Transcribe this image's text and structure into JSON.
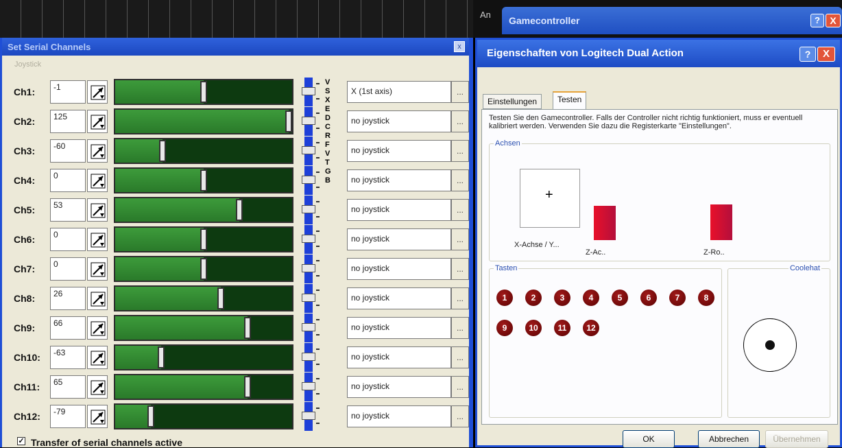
{
  "background": {
    "partial_label": "An"
  },
  "gamecontroller_window": {
    "title": "Gamecontroller",
    "help": "?",
    "close": "X"
  },
  "serial_window": {
    "title": "Set Serial Channels",
    "close": "x",
    "subtitle": "Joystick",
    "channels": [
      {
        "label": "Ch1:",
        "value": "-1",
        "level": 0.5,
        "joystick": "X (1st axis)"
      },
      {
        "label": "Ch2:",
        "value": "125",
        "level": 1.0,
        "joystick": "no joystick"
      },
      {
        "label": "Ch3:",
        "value": "-60",
        "level": 0.26,
        "joystick": "no joystick"
      },
      {
        "label": "Ch4:",
        "value": "0",
        "level": 0.5,
        "joystick": "no joystick"
      },
      {
        "label": "Ch5:",
        "value": "53",
        "level": 0.71,
        "joystick": "no joystick"
      },
      {
        "label": "Ch6:",
        "value": "0",
        "level": 0.5,
        "joystick": "no joystick"
      },
      {
        "label": "Ch7:",
        "value": "0",
        "level": 0.5,
        "joystick": "no joystick"
      },
      {
        "label": "Ch8:",
        "value": "26",
        "level": 0.6,
        "joystick": "no joystick"
      },
      {
        "label": "Ch9:",
        "value": "66",
        "level": 0.76,
        "joystick": "no joystick"
      },
      {
        "label": "Ch10:",
        "value": "-63",
        "level": 0.25,
        "joystick": "no joystick"
      },
      {
        "label": "Ch11:",
        "value": "65",
        "level": 0.76,
        "joystick": "no joystick"
      },
      {
        "label": "Ch12:",
        "value": "-79",
        "level": 0.19,
        "joystick": "no joystick"
      }
    ],
    "browse_label": "...",
    "side_letters": [
      "V",
      "S",
      "X",
      "E",
      "D",
      "C",
      "R",
      "F",
      "V",
      "T",
      "G",
      "B"
    ],
    "transfer_label": "Transfer of serial channels active",
    "transfer_checked": true
  },
  "properties_dialog": {
    "title": "Eigenschaften von Logitech Dual Action",
    "help": "?",
    "close": "X",
    "tabs": [
      {
        "label": "Einstellungen",
        "active": false
      },
      {
        "label": "Testen",
        "active": true
      }
    ],
    "description": "Testen Sie den Gamecontroller. Falls der Controller nicht richtig funktioniert, muss er eventuell kalibriert werden. Verwenden Sie dazu die Registerkarte \"Einstellungen\".",
    "axes_group": "Achsen",
    "axes": {
      "xy_label": "X-Achse / Y...",
      "xy_marker": "+",
      "z_axis_label": "Z-Ac..",
      "z_axis_level": 0.55,
      "z_rot_label": "Z-Ro..",
      "z_rot_level": 0.58
    },
    "buttons_group": "Tasten",
    "buttons": [
      "1",
      "2",
      "3",
      "4",
      "5",
      "6",
      "7",
      "8",
      "9",
      "10",
      "11",
      "12"
    ],
    "hat_group": "Coolehat",
    "footer": {
      "ok": "OK",
      "cancel": "Abbrechen",
      "apply": "Übernehmen"
    }
  },
  "colors": {
    "titlebar": "#1f4fc2",
    "slider_fill": "#3d9b3b",
    "slider_track": "#0d3a10",
    "axis_bar": "#e8102a",
    "button_dot": "#7a0a0a"
  }
}
